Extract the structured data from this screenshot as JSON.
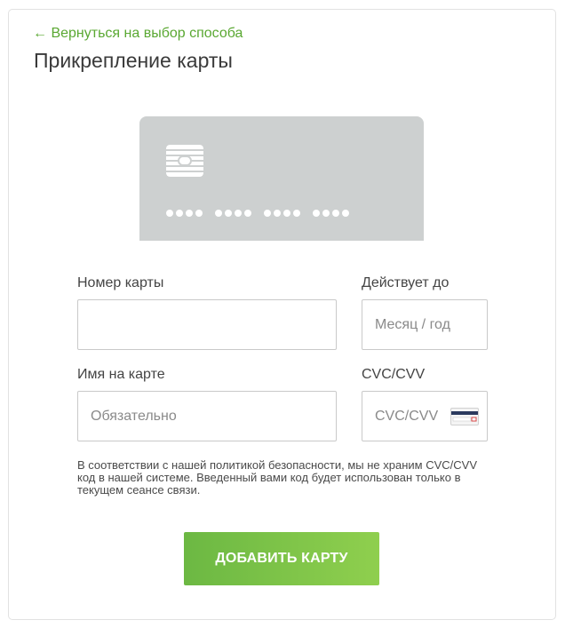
{
  "header": {
    "back_link": "← Вернуться на выбор способа",
    "title": "Прикрепление карты"
  },
  "card_preview": {
    "masked_groups": [
      "••••",
      "••••",
      "••••",
      "••••"
    ]
  },
  "form": {
    "card_number": {
      "label": "Номер карты",
      "value": "",
      "placeholder": ""
    },
    "expiry": {
      "label": "Действует до",
      "value": "",
      "placeholder": "Месяц / год"
    },
    "cardholder": {
      "label": "Имя на карте",
      "value": "",
      "placeholder": "Обязательно"
    },
    "cvc": {
      "label": "CVC/CVV",
      "value": "",
      "placeholder": "CVC/CVV"
    }
  },
  "security_note": "В соответствии с нашей политикой безопасности, мы не храним CVC/CVV код в нашей системе. Введенный вами код будет использован только в текущем сеансе связи.",
  "submit_label": "ДОБАВИТЬ КАРТУ",
  "colors": {
    "accent": "#5aa832",
    "card_bg": "#cdd0d0",
    "button_start": "#6cb843",
    "button_end": "#8fcf4e"
  }
}
